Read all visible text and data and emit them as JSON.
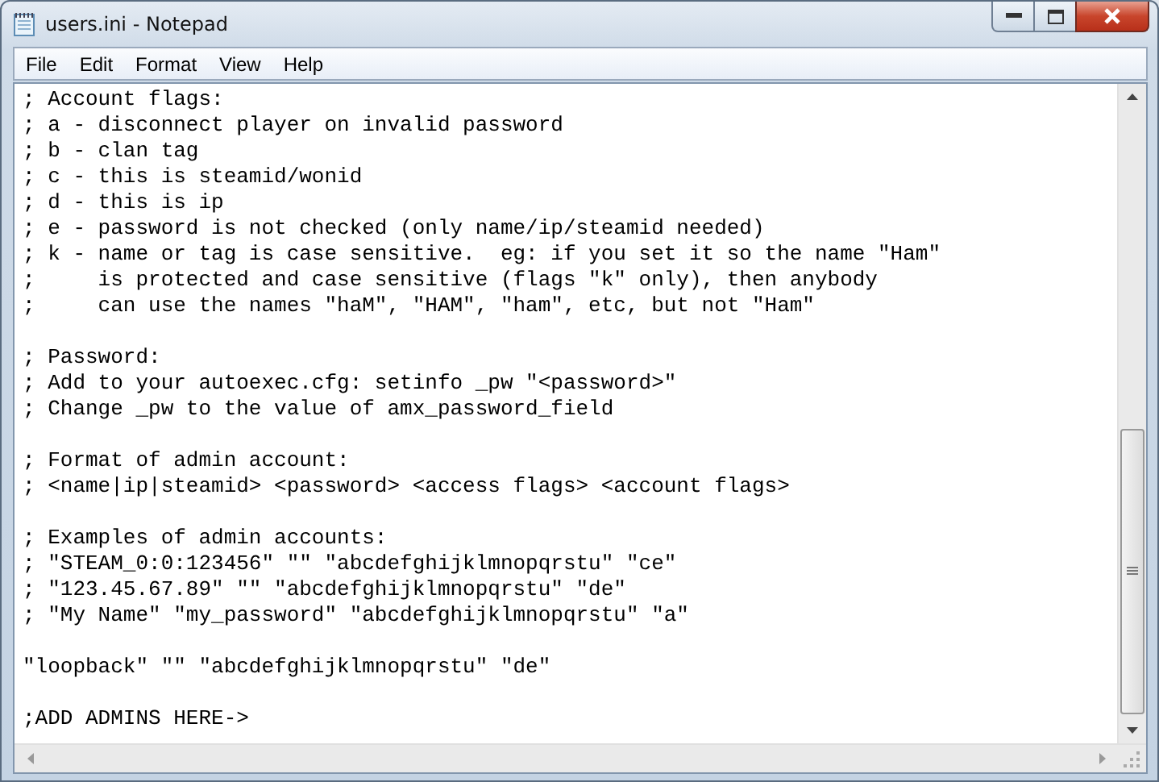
{
  "window": {
    "title": "users.ini - Notepad"
  },
  "menu": [
    "File",
    "Edit",
    "Format",
    "View",
    "Help"
  ],
  "editor": {
    "paragraphs": [
      [
        "; Account flags:",
        "; a - disconnect player on invalid password",
        "; b - clan tag",
        "; c - this is steamid/wonid",
        "; d - this is ip",
        "; e - password is not checked (only name/ip/steamid needed)",
        "; k - name or tag is case sensitive.  eg: if you set it so the name \"Ham\"",
        ";     is protected and case sensitive (flags \"k\" only), then anybody",
        ";     can use the names \"haM\", \"HAM\", \"ham\", etc, but not \"Ham\""
      ],
      [
        "; Password:",
        "; Add to your autoexec.cfg: setinfo _pw \"<password>\"",
        "; Change _pw to the value of amx_password_field"
      ],
      [
        "; Format of admin account:",
        "; <name|ip|steamid> <password> <access flags> <account flags>"
      ],
      [
        "; Examples of admin accounts:",
        "; \"STEAM_0:0:123456\" \"\" \"abcdefghijklmnopqrstu\" \"ce\"",
        "; \"123.45.67.89\" \"\" \"abcdefghijklmnopqrstu\" \"de\"",
        "; \"My Name\" \"my_password\" \"abcdefghijklmnopqrstu\" \"a\""
      ],
      [
        "\"loopback\" \"\" \"abcdefghijklmnopqrstu\" \"de\""
      ],
      [
        ";ADD ADMINS HERE->"
      ]
    ]
  }
}
